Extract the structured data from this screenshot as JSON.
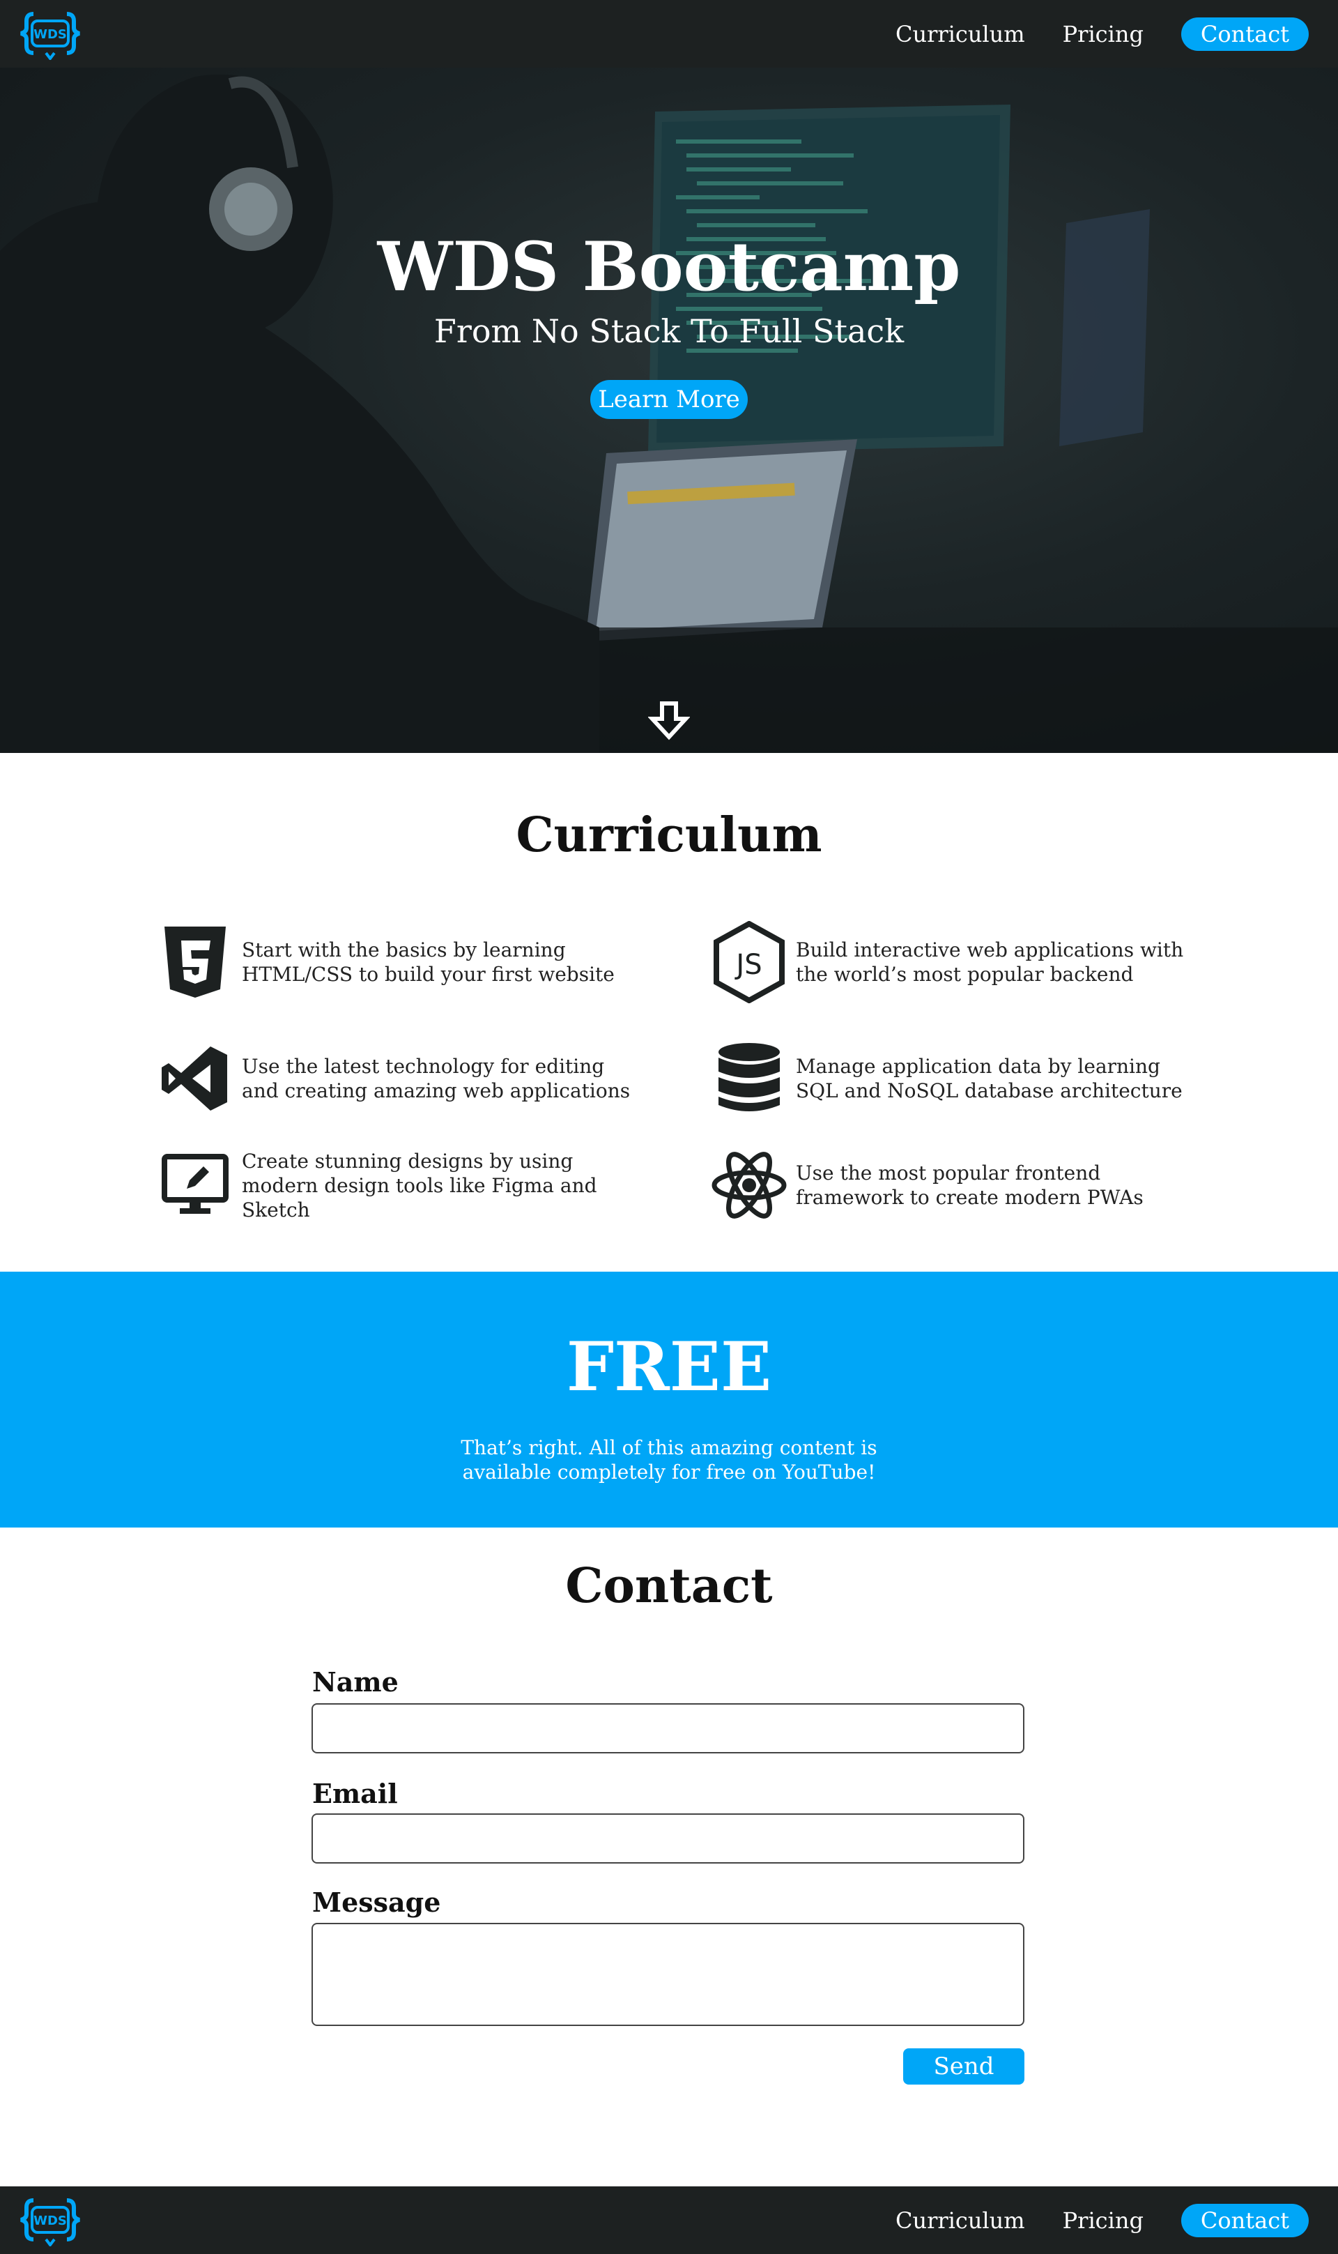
{
  "nav": {
    "logo_text": "WDS",
    "links": [
      "Curriculum",
      "Pricing"
    ],
    "cta": "Contact"
  },
  "hero": {
    "title": "WDS Bootcamp",
    "subtitle": "From No Stack To Full Stack",
    "button": "Learn More",
    "scroll_icon": "arrow-down-icon"
  },
  "curriculum": {
    "title": "Curriculum",
    "items": [
      {
        "icon": "html5-icon",
        "text": "Start with the basics by learning HTML/CSS to build your first website"
      },
      {
        "icon": "nodejs-icon",
        "text": "Build interactive web applications with the world’s most popular backend"
      },
      {
        "icon": "vscode-icon",
        "text": "Use the latest technology for editing and creating amazing web applications"
      },
      {
        "icon": "database-icon",
        "text": "Manage application data by learning SQL and NoSQL database architecture"
      },
      {
        "icon": "design-monitor-icon",
        "text": "Create stunning designs by using modern design tools like Figma and Sketch"
      },
      {
        "icon": "react-icon",
        "text": "Use the most popular frontend framework to create modern PWAs"
      }
    ]
  },
  "free": {
    "title": "FREE",
    "text": "That’s right. All of this amazing content is available completely for free on YouTube!"
  },
  "contact": {
    "title": "Contact",
    "name_label": "Name",
    "name_value": "",
    "email_label": "Email",
    "email_value": "",
    "message_label": "Message",
    "message_value": "",
    "send": "Send"
  },
  "colors": {
    "accent": "#00a6f7",
    "nav_bg": "#1d2121"
  }
}
